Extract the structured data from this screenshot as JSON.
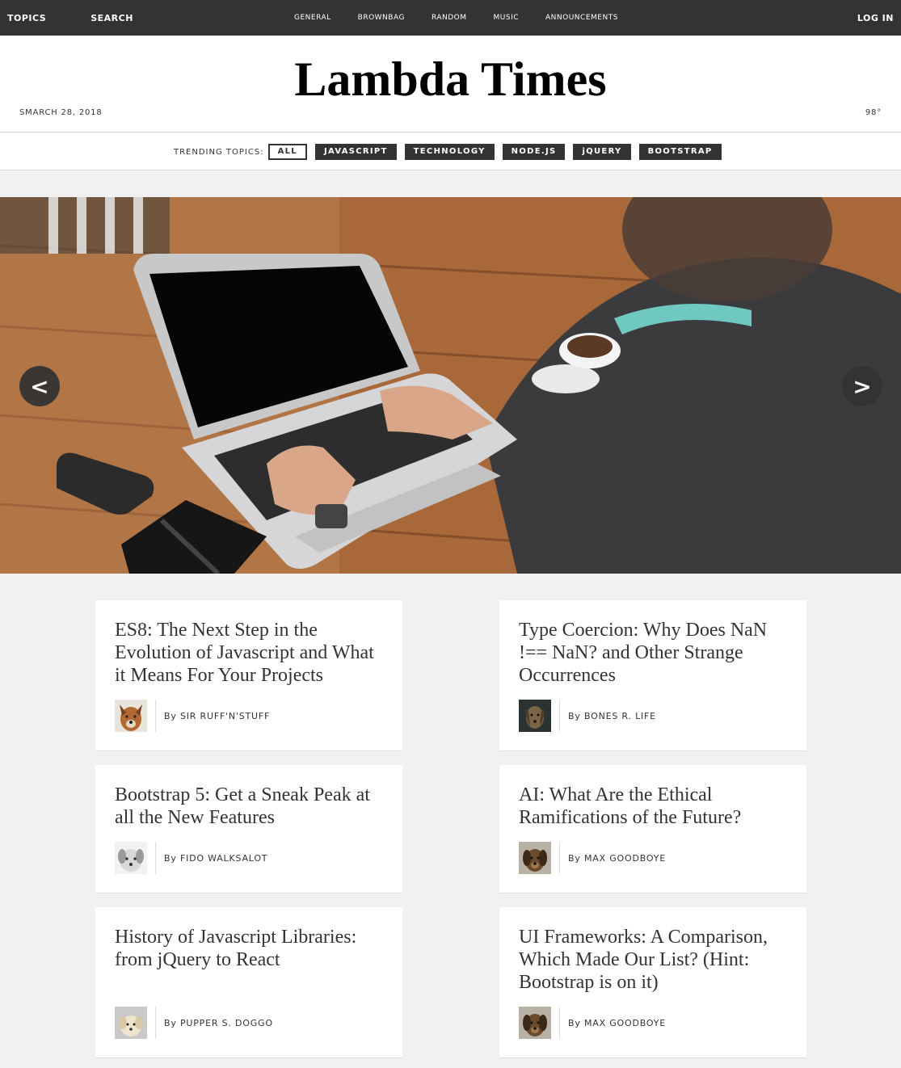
{
  "top_bar": {
    "topics": "TOPICS",
    "search": "SEARCH",
    "nav": [
      "GENERAL",
      "BROWNBAG",
      "RANDOM",
      "MUSIC",
      "ANNOUNCEMENTS"
    ],
    "login": "LOG IN"
  },
  "header": {
    "title": "Lambda Times",
    "date": "SMARCH 28, 2018",
    "temperature": "98°"
  },
  "trending": {
    "label": "TRENDING TOPICS:",
    "tabs": [
      "ALL",
      "JAVASCRIPT",
      "TECHNOLOGY",
      "NODE.JS",
      "jQUERY",
      "BOOTSTRAP"
    ],
    "active": "ALL"
  },
  "carousel": {
    "prev_label": "<",
    "next_label": ">"
  },
  "articles": [
    {
      "headline": "ES8: The Next Step in the Evolution of Javascript and What it Means For Your Projects",
      "author": "By SIR RUFF'N'STUFF"
    },
    {
      "headline": "Type Coercion: Why Does NaN !== NaN? and Other Strange Occurrences",
      "author": "By BONES R. LIFE"
    },
    {
      "headline": "Bootstrap 5: Get a Sneak Peak at all the New Features",
      "author": "By FIDO WALKSALOT"
    },
    {
      "headline": "AI: What Are the Ethical Ramifications of the Future?",
      "author": "By MAX GOODBOYE"
    },
    {
      "headline": "History of Javascript Libraries: from jQuery to React",
      "author": "By PUPPER S. DOGGO"
    },
    {
      "headline": "UI Frameworks: A Comparison, Which Made Our List? (Hint: Bootstrap is on it)",
      "author": "By MAX GOODBOYE"
    }
  ]
}
